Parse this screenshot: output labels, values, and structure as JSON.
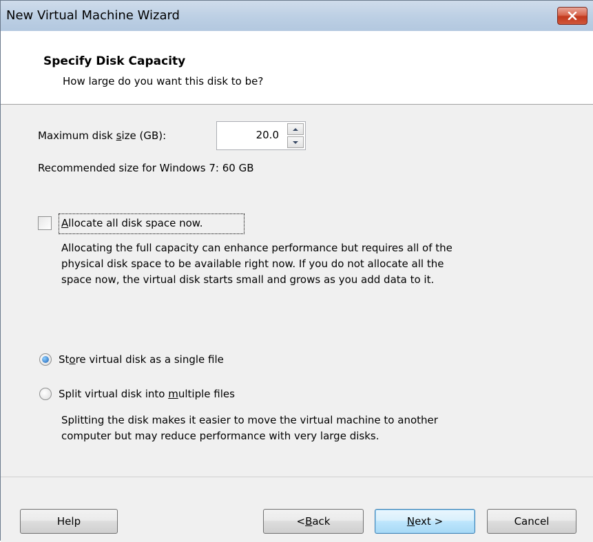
{
  "window": {
    "title": "New Virtual Machine Wizard",
    "close_glyph": "✕"
  },
  "header": {
    "title": "Specify Disk Capacity",
    "subtitle": "How large do you want this disk to be?"
  },
  "disk": {
    "size_label_pre": "Maximum disk ",
    "size_label_ul": "s",
    "size_label_post": "ize (GB):",
    "size_value": "20.0",
    "recommended": "Recommended size for Windows 7: 60 GB"
  },
  "allocate": {
    "label_ul": "A",
    "label_rest": "llocate all disk space now.",
    "checked": false,
    "description_lines": [
      "Allocating the full capacity can enhance performance but requires all of the",
      "physical disk space to be available right now. If you do not allocate all the",
      "space now, the virtual disk starts small and grows as you add data to it."
    ]
  },
  "storage_options": {
    "single_pre": "St",
    "single_ul": "o",
    "single_post": "re virtual disk as a single file",
    "split_pre": "Split virtual disk into ",
    "split_ul": "m",
    "split_post": "ultiple files",
    "selected": "single",
    "split_description_lines": [
      "Splitting the disk makes it easier to move the virtual machine to another",
      "computer but may reduce performance with very large disks."
    ]
  },
  "buttons": {
    "help": "Help",
    "back_pre": "< ",
    "back_ul": "B",
    "back_post": "ack",
    "next_ul": "N",
    "next_post": "ext >",
    "cancel": "Cancel"
  },
  "colors": {
    "close_button": "#c9452b",
    "default_button_border": "#3c7fb1",
    "radio_selected": "#1a5fb4"
  }
}
